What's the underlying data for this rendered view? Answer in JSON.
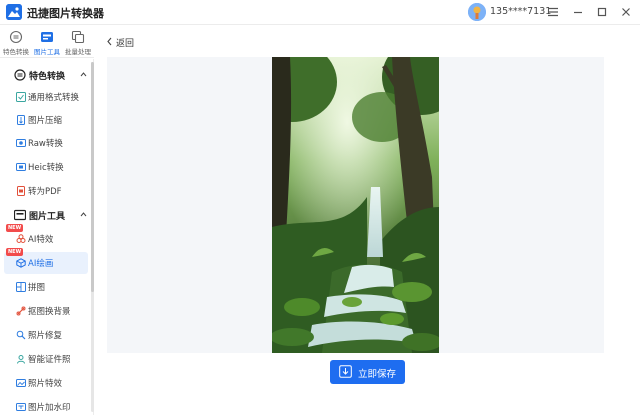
{
  "app": {
    "title": "迅捷图片转换器",
    "user_phone": "135****7131"
  },
  "window_controls": [
    "menu-icon",
    "minimize-icon",
    "maximize-icon",
    "close-icon"
  ],
  "topnav": [
    {
      "label": "特色转换",
      "icon": "convert-icon",
      "active": false
    },
    {
      "label": "图片工具",
      "icon": "tools-icon",
      "active": true
    },
    {
      "label": "批量处理",
      "icon": "batch-icon",
      "active": false
    }
  ],
  "sidebar": {
    "sections": [
      {
        "label": "特色转换",
        "icon": "convert-section-icon",
        "items": [
          {
            "label": "通用格式转换",
            "icon": "format-icon"
          },
          {
            "label": "图片压缩",
            "icon": "compress-icon"
          },
          {
            "label": "Raw转换",
            "icon": "raw-icon"
          },
          {
            "label": "Heic转换",
            "icon": "heic-icon"
          },
          {
            "label": "转为PDF",
            "icon": "pdf-icon"
          }
        ]
      },
      {
        "label": "图片工具",
        "icon": "tools-section-icon",
        "items": [
          {
            "label": "AI特效",
            "icon": "ai-effect-icon",
            "badge": "NEW"
          },
          {
            "label": "AI绘画",
            "icon": "ai-paint-icon",
            "badge": "NEW",
            "active": true
          },
          {
            "label": "拼图",
            "icon": "collage-icon"
          },
          {
            "label": "抠图换背景",
            "icon": "cutout-icon"
          },
          {
            "label": "照片修复",
            "icon": "repair-icon"
          },
          {
            "label": "智能证件照",
            "icon": "id-photo-icon"
          },
          {
            "label": "照片特效",
            "icon": "photo-effect-icon"
          },
          {
            "label": "图片加水印",
            "icon": "watermark-icon"
          }
        ]
      }
    ]
  },
  "main": {
    "back_label": "返回",
    "preview_alt": "forest waterfall",
    "save_label": "立即保存"
  },
  "colors": {
    "accent": "#1e6df0",
    "active_bg": "#e9f1fd",
    "badge": "#f24b4b",
    "canvas_bg": "#f4f6f9"
  }
}
